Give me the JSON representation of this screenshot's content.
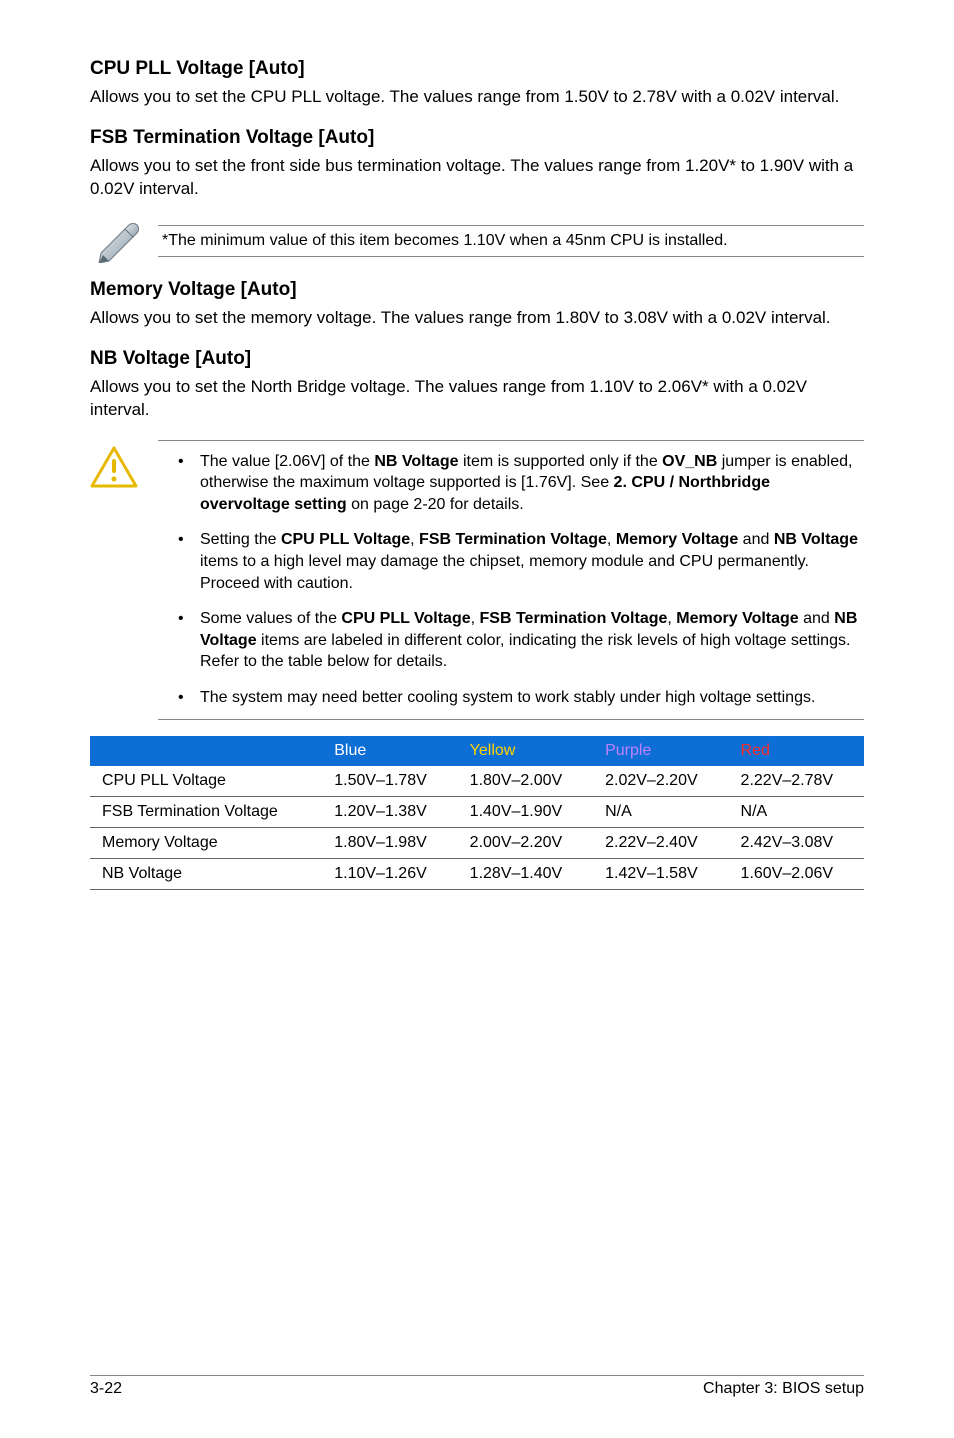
{
  "sections": {
    "cpu_pll": {
      "title": "CPU PLL Voltage [Auto]",
      "body": "Allows you to set the CPU PLL voltage. The values range from 1.50V to 2.78V with a 0.02V interval."
    },
    "fsb": {
      "title": "FSB Termination Voltage [Auto]",
      "body": "Allows you to set the front side bus termination voltage. The values range from 1.20V* to 1.90V with a 0.02V interval."
    },
    "memory": {
      "title": "Memory Voltage [Auto]",
      "body": "Allows you to set the memory voltage. The values range from 1.80V to 3.08V with a 0.02V interval."
    },
    "nb": {
      "title": "NB Voltage [Auto]",
      "body": "Allows you to set the North Bridge voltage. The values range from 1.10V to 2.06V* with a 0.02V interval."
    }
  },
  "note": {
    "text": "*The minimum value of this item becomes 1.10V when a 45nm CPU is installed."
  },
  "warnings": {
    "items": [
      {
        "pre1": "The value [2.06V] of the ",
        "b1": "NB Voltage",
        "mid1": " item is supported only if the ",
        "b2": "OV_NB",
        "post1": " jumper is enabled, otherwise the maximum voltage supported is [1.76V]. See ",
        "b3": "2. CPU / Northbridge overvoltage setting",
        "post2": " on page 2-20 for details."
      },
      {
        "pre1": "Setting the ",
        "b1": "CPU PLL Voltage",
        "mid1": ", ",
        "b2": "FSB Termination Voltage",
        "mid2": ", ",
        "b3": "Memory Voltage",
        "mid3": " and ",
        "b4": "NB Voltage",
        "post1": " items to a high level may damage the chipset, memory module and CPU permanently. Proceed with caution."
      },
      {
        "pre1": "Some values of the ",
        "b1": "CPU PLL Voltage",
        "mid1": ", ",
        "b2": "FSB Termination Voltage",
        "mid2": ", ",
        "b3": "Memory Voltage",
        "mid3": " and ",
        "b4": "NB Voltage",
        "post1": " items are labeled in different color, indicating the risk levels of high voltage settings. Refer to the table below for details."
      },
      {
        "plain": "The system may need better cooling system to work stably under high voltage settings."
      }
    ]
  },
  "table": {
    "headers": [
      "",
      "Blue",
      "Yellow",
      "Purple",
      "Red"
    ],
    "rows": [
      {
        "label": "CPU PLL Voltage",
        "blue": "1.50V–1.78V",
        "yellow": "1.80V–2.00V",
        "purple": "2.02V–2.20V",
        "red": "2.22V–2.78V"
      },
      {
        "label": "FSB Termination Voltage",
        "blue": "1.20V–1.38V",
        "yellow": "1.40V–1.90V",
        "purple": "N/A",
        "red": "N/A"
      },
      {
        "label": "Memory Voltage",
        "blue": "1.80V–1.98V",
        "yellow": "2.00V–2.20V",
        "purple": "2.22V–2.40V",
        "red": "2.42V–3.08V"
      },
      {
        "label": "NB Voltage",
        "blue": "1.10V–1.26V",
        "yellow": "1.28V–1.40V",
        "purple": "1.42V–1.58V",
        "red": "1.60V–2.06V"
      }
    ]
  },
  "footer": {
    "left": "3-22",
    "right": "Chapter 3: BIOS setup"
  }
}
